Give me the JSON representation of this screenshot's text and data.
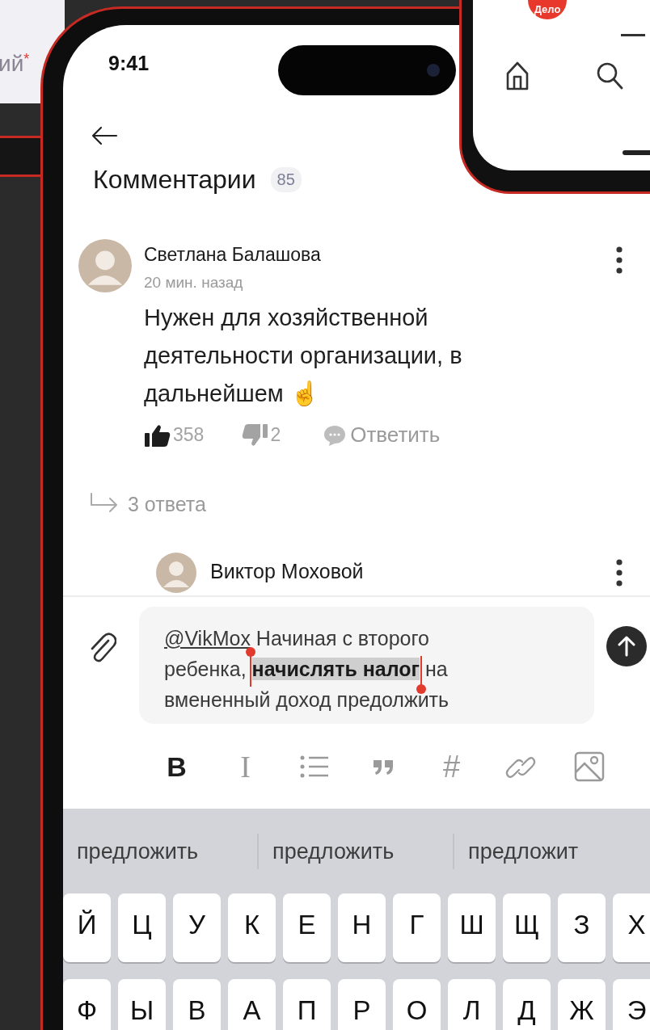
{
  "background_screen": {
    "label_fragment": "ий",
    "required_mark": "*"
  },
  "mini_phone": {
    "logo": "Дело"
  },
  "status_bar": {
    "time": "9:41"
  },
  "header": {
    "title": "Комментарии",
    "count": "85"
  },
  "comment": {
    "author": "Светлана Балашова",
    "time": "20 мин. назад",
    "text": "Нужен для хозяйственной деятельности организации, в дальнейшем ☝️",
    "likes": "358",
    "dislikes": "2",
    "reply": "Ответить"
  },
  "replies_toggle": "3 ответа",
  "reply": {
    "author": "Виктор Моховой"
  },
  "composer": {
    "mention": "@VikMox",
    "text_before": " Начиная с второго ребенка, ",
    "selected_text": "начислять налог",
    "text_after": " на вмененный доход предолжить"
  },
  "format_buttons": [
    {
      "kind": "bold",
      "label": "B"
    },
    {
      "kind": "italic",
      "label": "I"
    },
    {
      "kind": "list"
    },
    {
      "kind": "quote"
    },
    {
      "kind": "hashtag",
      "label": "#"
    },
    {
      "kind": "link"
    },
    {
      "kind": "image"
    }
  ],
  "suggestions": [
    "предложить",
    "предложить",
    "предложит"
  ],
  "keyboard": {
    "rows": [
      [
        "Й",
        "Ц",
        "У",
        "К",
        "Е",
        "Н",
        "Г",
        "Ш",
        "Щ",
        "З",
        "Х"
      ],
      [
        "Ф",
        "Ы",
        "В",
        "А",
        "П",
        "Р",
        "О",
        "Л",
        "Д",
        "Ж",
        "Э"
      ]
    ]
  }
}
